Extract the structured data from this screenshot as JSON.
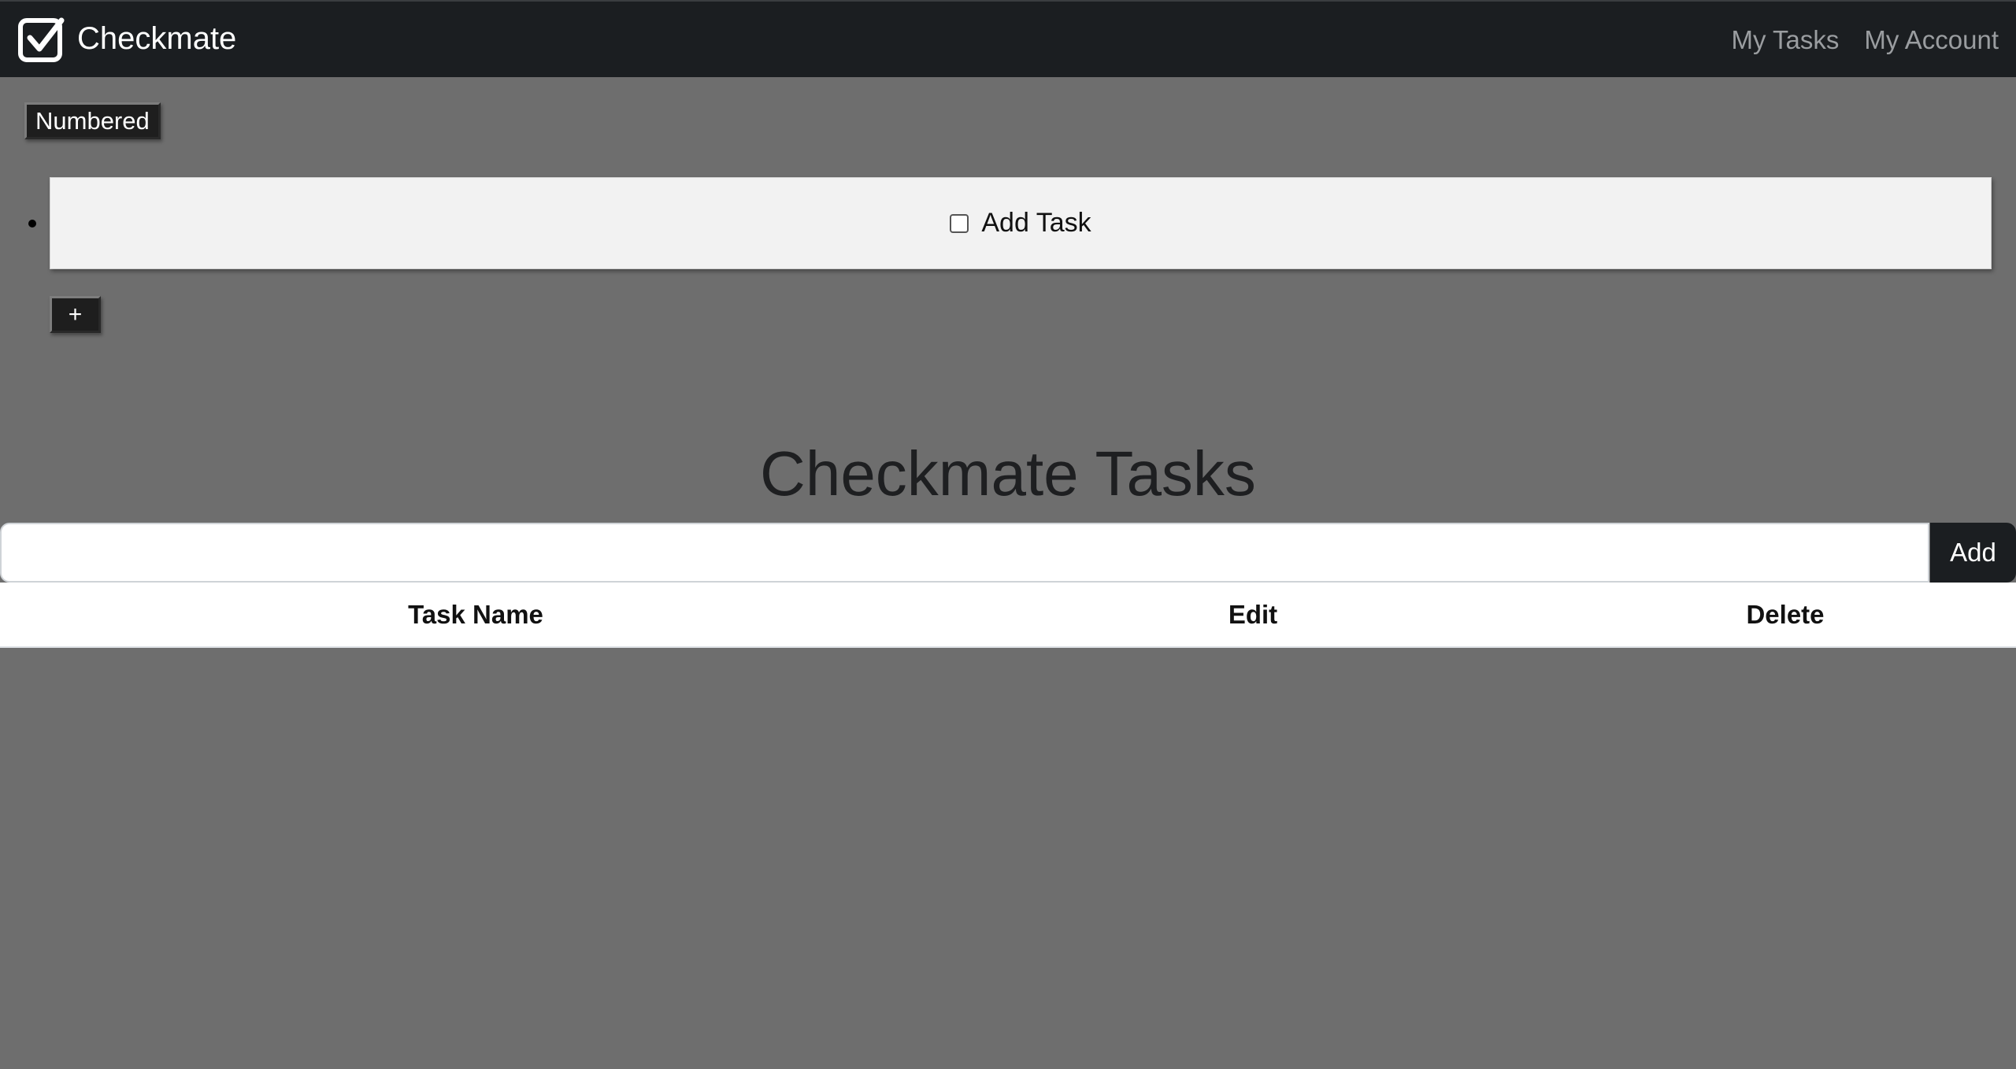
{
  "navbar": {
    "brand": "Checkmate",
    "brand_icon": "checkbox-check-icon",
    "links": [
      "My Tasks",
      "My Account"
    ]
  },
  "list_controls": {
    "numbered_label": "Numbered",
    "add_item_label": "+"
  },
  "task_items": [
    {
      "label": "Add Task",
      "checked": false
    }
  ],
  "main": {
    "title": "Checkmate Tasks",
    "input_value": "",
    "add_button_label": "Add"
  },
  "table": {
    "headers": [
      "Task Name",
      "Edit",
      "Delete"
    ],
    "rows": []
  },
  "colors": {
    "navbar_bg": "#1b1e21",
    "page_bg": "#6e6e6e",
    "task_bg": "#f2f2f2"
  }
}
